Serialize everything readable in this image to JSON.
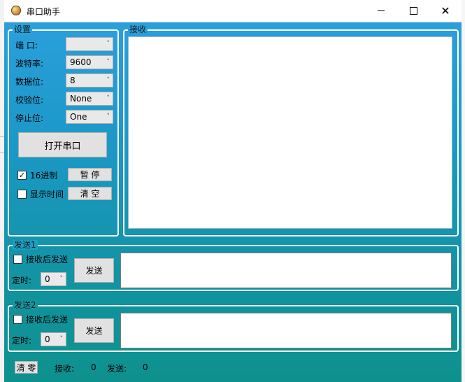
{
  "window": {
    "title": "串口助手",
    "controls": {
      "minimize": "—",
      "maximize": "☐",
      "close": "✕"
    }
  },
  "settings": {
    "group_title": "设置",
    "port_label": "端 口:",
    "port_value": "",
    "baud_label": "波特率:",
    "baud_value": "9600",
    "databits_label": "数据位:",
    "databits_value": "8",
    "parity_label": "校验位:",
    "parity_value": "None",
    "stopbits_label": "停止位:",
    "stopbits_value": "One",
    "open_button": "打开串口",
    "hex_label": "16进制",
    "hex_checked": "✓",
    "pause_button": "暂 停",
    "show_time_label": "显示时间",
    "clear_button": "清 空"
  },
  "receive": {
    "group_title": "接收",
    "text": ""
  },
  "send1": {
    "group_title": "发送1",
    "after_receive_label": "接收后发送",
    "timer_label": "定时:",
    "timer_value": "0",
    "send_button": "发送",
    "text": ""
  },
  "send2": {
    "group_title": "发送2",
    "after_receive_label": "接收后发送",
    "timer_label": "定时:",
    "timer_value": "0",
    "send_button": "发送",
    "text": ""
  },
  "status": {
    "reset_button": "清 零",
    "rx_label": "接收:",
    "rx_count": "0",
    "tx_label": "发送:",
    "tx_count": "0"
  },
  "icons": {
    "dropdown": "˅"
  },
  "colors": {
    "gradient_top": "#2b9fdc",
    "gradient_bottom": "#0e918d",
    "group_border": "#ffffff"
  }
}
